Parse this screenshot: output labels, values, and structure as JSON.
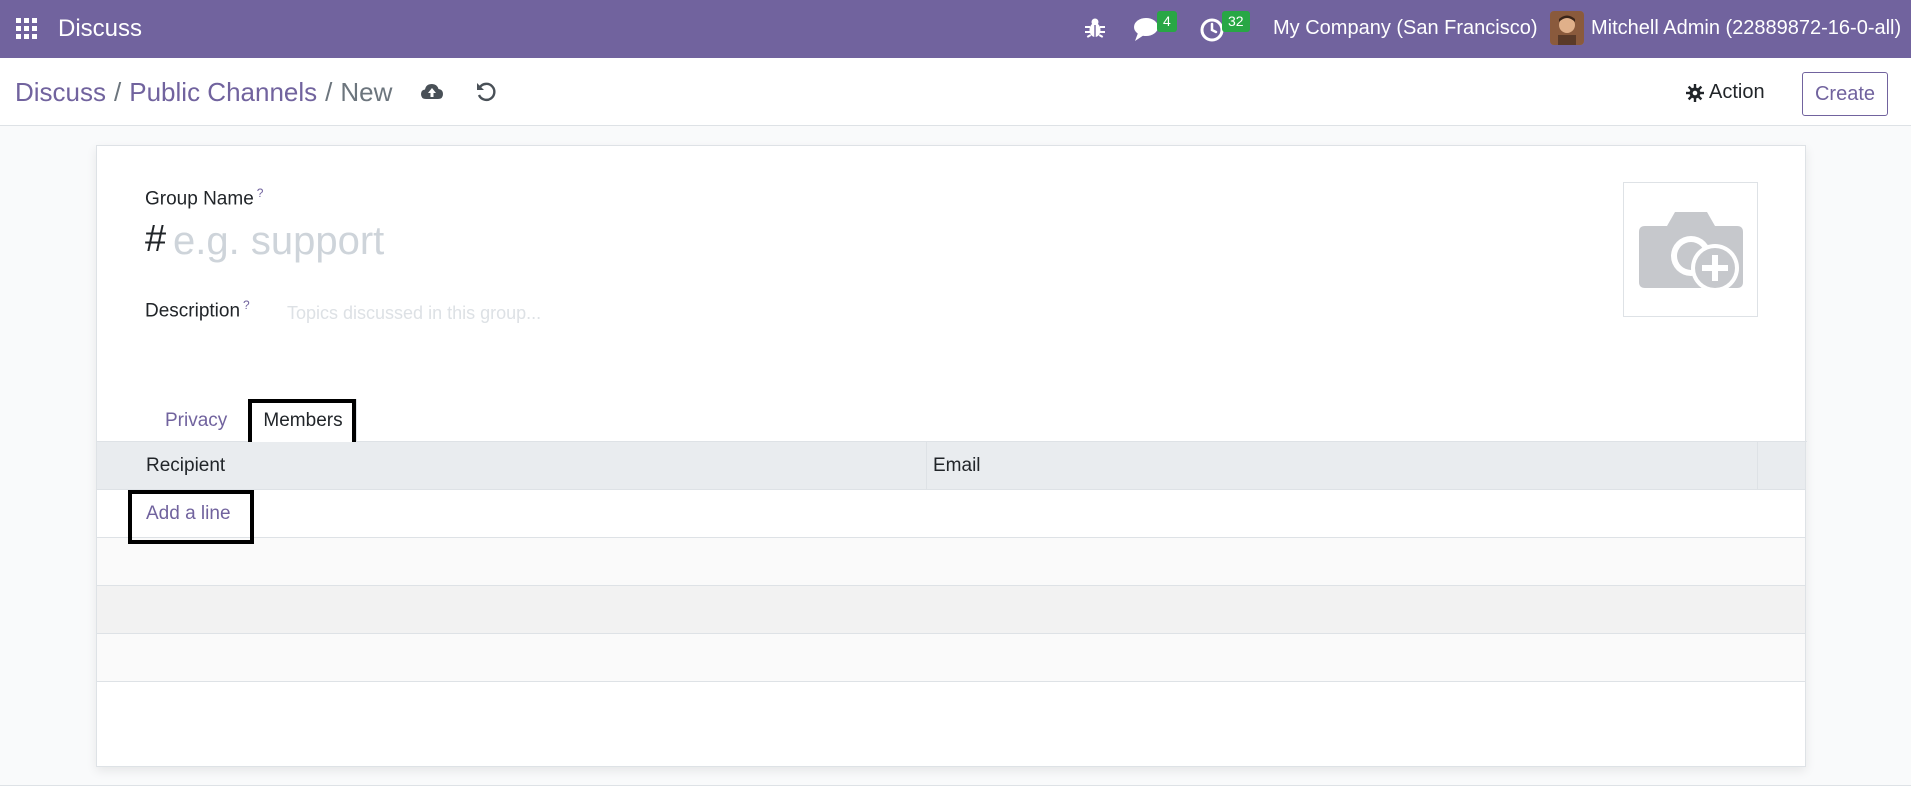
{
  "navbar": {
    "app_name": "Discuss",
    "icons": [
      "apps-grid-icon",
      "bug-icon",
      "chat-icon",
      "activity-clock-icon"
    ],
    "messages_count": "4",
    "activities_count": "32",
    "company": "My Company (San Francisco)",
    "user": "Mitchell Admin (22889872-16-0-all)",
    "brand_color": "#71639e",
    "badge_color": "#28a745"
  },
  "control_panel": {
    "breadcrumb": [
      "Discuss",
      "Public Channels",
      "New"
    ],
    "separator": "/",
    "action_label": "Action",
    "create_label": "Create"
  },
  "form": {
    "group_name_label": "Group Name",
    "help_mark": "?",
    "hash": "#",
    "group_name_placeholder": "e.g. support",
    "description_label": "Description",
    "description_placeholder": "Topics discussed in this group...",
    "tabs": [
      {
        "label": "Privacy",
        "active": false
      },
      {
        "label": "Members",
        "active": true
      }
    ],
    "table": {
      "columns": [
        "Recipient",
        "Email"
      ],
      "add_line_label": "Add a line"
    }
  }
}
